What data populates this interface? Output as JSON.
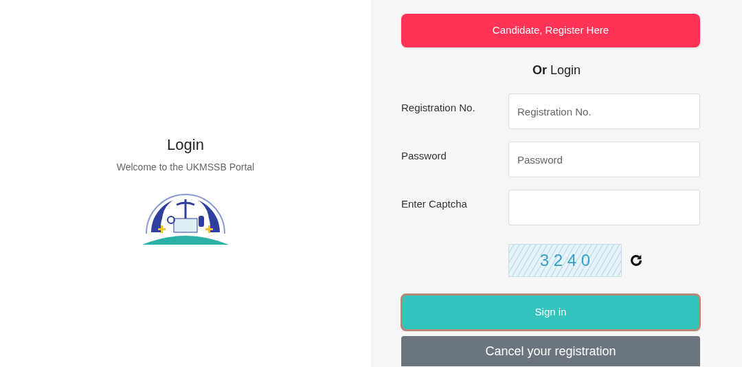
{
  "intro": {
    "title": "Login",
    "subtitle": "Welcome to the UKMSSB Portal"
  },
  "register_button": "Candidate, Register Here",
  "divider_text": "**Or** Login",
  "fields": [
    {
      "label": "Registration No.",
      "placeholder": "Registration No."
    },
    {
      "label": "Password",
      "placeholder": "Password"
    },
    {
      "label": "Enter Captcha"
    }
  ],
  "captcha": {
    "code": "3 2 4 0"
  },
  "sign_in_button": {
    "label": "Sign in",
    "focused": true
  },
  "cancel_button": "Cancel your registration"
}
